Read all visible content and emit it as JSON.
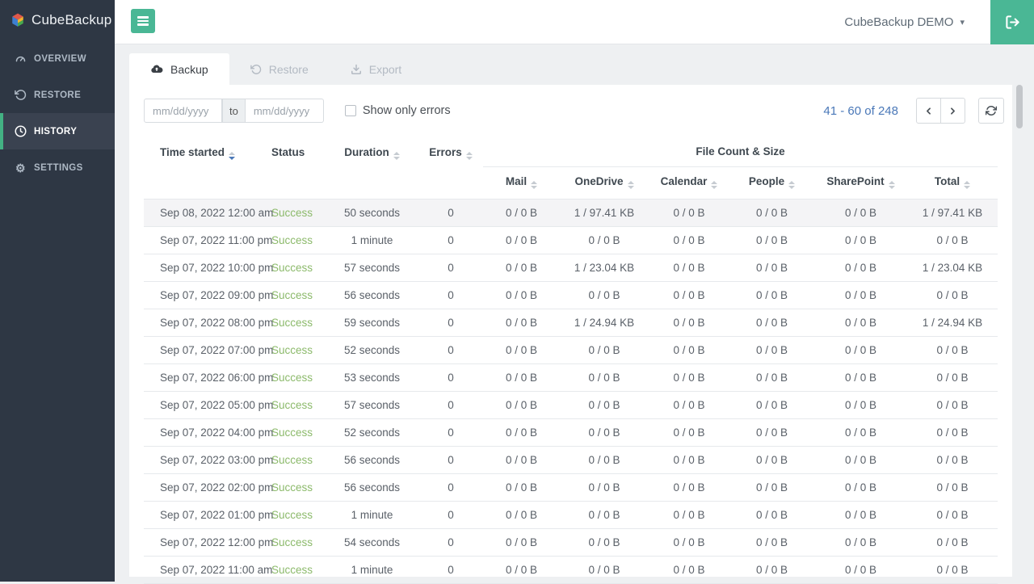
{
  "app": {
    "brand": "CubeBackup"
  },
  "topbar": {
    "account_label": "CubeBackup DEMO",
    "menu_icon": "hamburger-icon",
    "account_caret_icon": "caret-down-icon",
    "logout_icon": "sign-out-icon"
  },
  "sidebar": {
    "items": [
      {
        "label": "OVERVIEW",
        "icon": "dashboard-icon",
        "active": false
      },
      {
        "label": "RESTORE",
        "icon": "restore-icon",
        "active": false
      },
      {
        "label": "HISTORY",
        "icon": "history-icon",
        "active": true
      },
      {
        "label": "SETTINGS",
        "icon": "settings-icon",
        "active": false
      }
    ]
  },
  "tabs": [
    {
      "label": "Backup",
      "icon": "cloud-backup-icon",
      "active": true
    },
    {
      "label": "Restore",
      "icon": "restore-icon",
      "active": false
    },
    {
      "label": "Export",
      "icon": "export-icon",
      "active": false
    }
  ],
  "filters": {
    "date_from_placeholder": "mm/dd/yyyy",
    "date_from_value": "",
    "separator": "to",
    "date_to_placeholder": "mm/dd/yyyy",
    "date_to_value": "",
    "show_only_errors_label": "Show only errors",
    "show_only_errors_checked": false
  },
  "pagination": {
    "range": "41 - 60 of 248"
  },
  "table": {
    "group_header": "File Count & Size",
    "primary_columns": [
      {
        "label": "Time started",
        "sortable": true,
        "sort": "desc"
      },
      {
        "label": "Status",
        "sortable": false,
        "sort": null
      },
      {
        "label": "Duration",
        "sortable": true,
        "sort": null
      },
      {
        "label": "Errors",
        "sortable": true,
        "sort": null
      }
    ],
    "secondary_columns": [
      {
        "label": "Mail",
        "sortable": true
      },
      {
        "label": "OneDrive",
        "sortable": true
      },
      {
        "label": "Calendar",
        "sortable": true
      },
      {
        "label": "People",
        "sortable": true
      },
      {
        "label": "SharePoint",
        "sortable": true
      },
      {
        "label": "Total",
        "sortable": true
      }
    ],
    "rows": [
      {
        "highlight": true,
        "cells": [
          "Sep 08, 2022 12:00 am",
          "Success",
          "50 seconds",
          "0",
          "0 / 0 B",
          "1 / 97.41 KB",
          "0 / 0 B",
          "0 / 0 B",
          "0 / 0 B",
          "1 / 97.41 KB"
        ]
      },
      {
        "highlight": false,
        "cells": [
          "Sep 07, 2022 11:00 pm",
          "Success",
          "1 minute",
          "0",
          "0 / 0 B",
          "0 / 0 B",
          "0 / 0 B",
          "0 / 0 B",
          "0 / 0 B",
          "0 / 0 B"
        ]
      },
      {
        "highlight": false,
        "cells": [
          "Sep 07, 2022 10:00 pm",
          "Success",
          "57 seconds",
          "0",
          "0 / 0 B",
          "1 / 23.04 KB",
          "0 / 0 B",
          "0 / 0 B",
          "0 / 0 B",
          "1 / 23.04 KB"
        ]
      },
      {
        "highlight": false,
        "cells": [
          "Sep 07, 2022 09:00 pm",
          "Success",
          "56 seconds",
          "0",
          "0 / 0 B",
          "0 / 0 B",
          "0 / 0 B",
          "0 / 0 B",
          "0 / 0 B",
          "0 / 0 B"
        ]
      },
      {
        "highlight": false,
        "cells": [
          "Sep 07, 2022 08:00 pm",
          "Success",
          "59 seconds",
          "0",
          "0 / 0 B",
          "1 / 24.94 KB",
          "0 / 0 B",
          "0 / 0 B",
          "0 / 0 B",
          "1 / 24.94 KB"
        ]
      },
      {
        "highlight": false,
        "cells": [
          "Sep 07, 2022 07:00 pm",
          "Success",
          "52 seconds",
          "0",
          "0 / 0 B",
          "0 / 0 B",
          "0 / 0 B",
          "0 / 0 B",
          "0 / 0 B",
          "0 / 0 B"
        ]
      },
      {
        "highlight": false,
        "cells": [
          "Sep 07, 2022 06:00 pm",
          "Success",
          "53 seconds",
          "0",
          "0 / 0 B",
          "0 / 0 B",
          "0 / 0 B",
          "0 / 0 B",
          "0 / 0 B",
          "0 / 0 B"
        ]
      },
      {
        "highlight": false,
        "cells": [
          "Sep 07, 2022 05:00 pm",
          "Success",
          "57 seconds",
          "0",
          "0 / 0 B",
          "0 / 0 B",
          "0 / 0 B",
          "0 / 0 B",
          "0 / 0 B",
          "0 / 0 B"
        ]
      },
      {
        "highlight": false,
        "cells": [
          "Sep 07, 2022 04:00 pm",
          "Success",
          "52 seconds",
          "0",
          "0 / 0 B",
          "0 / 0 B",
          "0 / 0 B",
          "0 / 0 B",
          "0 / 0 B",
          "0 / 0 B"
        ]
      },
      {
        "highlight": false,
        "cells": [
          "Sep 07, 2022 03:00 pm",
          "Success",
          "56 seconds",
          "0",
          "0 / 0 B",
          "0 / 0 B",
          "0 / 0 B",
          "0 / 0 B",
          "0 / 0 B",
          "0 / 0 B"
        ]
      },
      {
        "highlight": false,
        "cells": [
          "Sep 07, 2022 02:00 pm",
          "Success",
          "56 seconds",
          "0",
          "0 / 0 B",
          "0 / 0 B",
          "0 / 0 B",
          "0 / 0 B",
          "0 / 0 B",
          "0 / 0 B"
        ]
      },
      {
        "highlight": false,
        "cells": [
          "Sep 07, 2022 01:00 pm",
          "Success",
          "1 minute",
          "0",
          "0 / 0 B",
          "0 / 0 B",
          "0 / 0 B",
          "0 / 0 B",
          "0 / 0 B",
          "0 / 0 B"
        ]
      },
      {
        "highlight": false,
        "cells": [
          "Sep 07, 2022 12:00 pm",
          "Success",
          "54 seconds",
          "0",
          "0 / 0 B",
          "0 / 0 B",
          "0 / 0 B",
          "0 / 0 B",
          "0 / 0 B",
          "0 / 0 B"
        ]
      },
      {
        "highlight": false,
        "cells": [
          "Sep 07, 2022 11:00 am",
          "Success",
          "1 minute",
          "0",
          "0 / 0 B",
          "0 / 0 B",
          "0 / 0 B",
          "0 / 0 B",
          "0 / 0 B",
          "0 / 0 B"
        ]
      }
    ]
  },
  "colors": {
    "accent_green": "#4ab795",
    "sidebar_bg": "#2e3744",
    "sidebar_active_bg": "#3a4250",
    "active_green_bar": "#43b183",
    "link_blue": "#4a78b8",
    "success_green": "#8cba6b"
  }
}
